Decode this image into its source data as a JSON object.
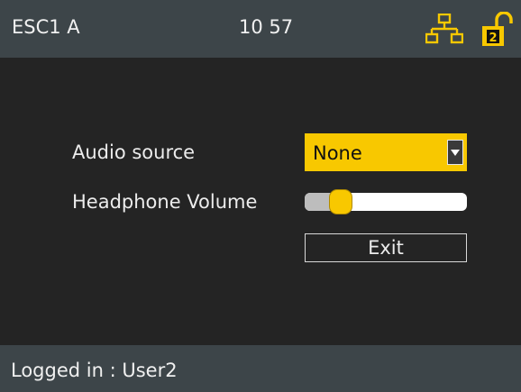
{
  "header": {
    "device_name": "ESC1 A",
    "time": "10 57",
    "network_icon": "network-icon",
    "lock_icon": "unlocked-padlock-icon",
    "lock_badge": "2",
    "accent_color": "#f8c800"
  },
  "form": {
    "audio_source": {
      "label": "Audio source",
      "selected": "None",
      "arrow_icon": "chevron-down-icon"
    },
    "headphone_volume": {
      "label": "Headphone Volume",
      "level_fraction": 0.22
    },
    "exit_label": "Exit"
  },
  "status": {
    "text": "Logged in : User2"
  },
  "colors": {
    "background": "#242424",
    "bar": "#3d4549",
    "accent": "#f8c800"
  }
}
